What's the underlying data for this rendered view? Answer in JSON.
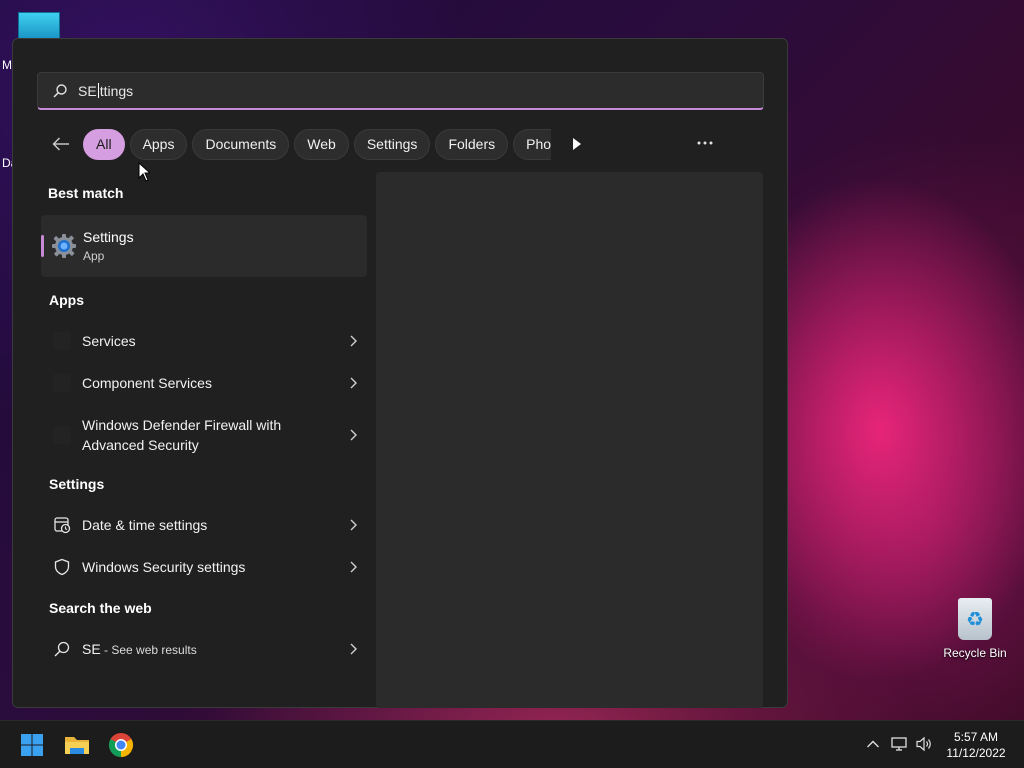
{
  "desktop": {
    "fragment_m": "M",
    "fragment_d": "Da",
    "recycle_bin_label": "Recycle Bin"
  },
  "search": {
    "typed": "SE",
    "completion": "ttings",
    "accent_color": "#c78bd6"
  },
  "filters": {
    "chips": [
      "All",
      "Apps",
      "Documents",
      "Web",
      "Settings",
      "Folders",
      "Phot"
    ],
    "active": "All"
  },
  "best_match": {
    "section_title": "Best match",
    "title": "Settings",
    "subtitle": "App",
    "icon": "gear-icon"
  },
  "apps": {
    "section_title": "Apps",
    "items": [
      {
        "label": "Services"
      },
      {
        "label": "Component Services"
      },
      {
        "label_line1": "Windows Defender Firewall with",
        "label_line2": "Advanced Security"
      }
    ]
  },
  "settings": {
    "section_title": "Settings",
    "items": [
      {
        "label": "Date & time settings",
        "icon": "date-time-settings-icon"
      },
      {
        "label": "Windows Security settings",
        "icon": "shield-icon"
      }
    ]
  },
  "web": {
    "section_title": "Search the web",
    "query": "SE",
    "suffix": " - See web results"
  },
  "taskbar": {
    "time": "5:57 AM",
    "date": "11/12/2022"
  }
}
